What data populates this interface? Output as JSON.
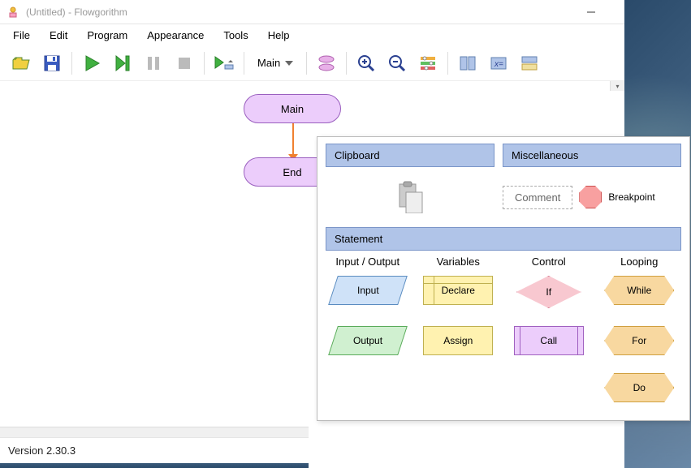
{
  "window": {
    "title": "(Untitled) - Flowgorithm"
  },
  "menus": {
    "file": "File",
    "edit": "Edit",
    "program": "Program",
    "appearance": "Appearance",
    "tools": "Tools",
    "help": "Help"
  },
  "toolbar": {
    "function_selected": "Main"
  },
  "flowchart": {
    "start_label": "Main",
    "end_label": "End"
  },
  "popup": {
    "clipboard_hdr": "Clipboard",
    "misc_hdr": "Miscellaneous",
    "comment": "Comment",
    "breakpoint": "Breakpoint",
    "statement_hdr": "Statement",
    "cols": {
      "io": "Input / Output",
      "vars": "Variables",
      "ctrl": "Control",
      "loop": "Looping"
    },
    "shapes": {
      "input": "Input",
      "output": "Output",
      "declare": "Declare",
      "assign": "Assign",
      "if": "If",
      "call": "Call",
      "while": "While",
      "for": "For",
      "do": "Do"
    }
  },
  "status": {
    "version": "Version 2.30.3"
  },
  "icons": {
    "open": "open-icon",
    "save": "save-icon",
    "run": "run-icon",
    "step": "step-icon",
    "pause": "pause-icon",
    "stop": "stop-icon",
    "speed": "speed-icon",
    "layout": "layout-icon",
    "zoomin": "zoom-in-icon",
    "zoomout": "zoom-out-icon",
    "settings": "settings-icon",
    "panel1": "panel1-icon",
    "vars": "vars-icon",
    "panel2": "panel2-icon"
  }
}
